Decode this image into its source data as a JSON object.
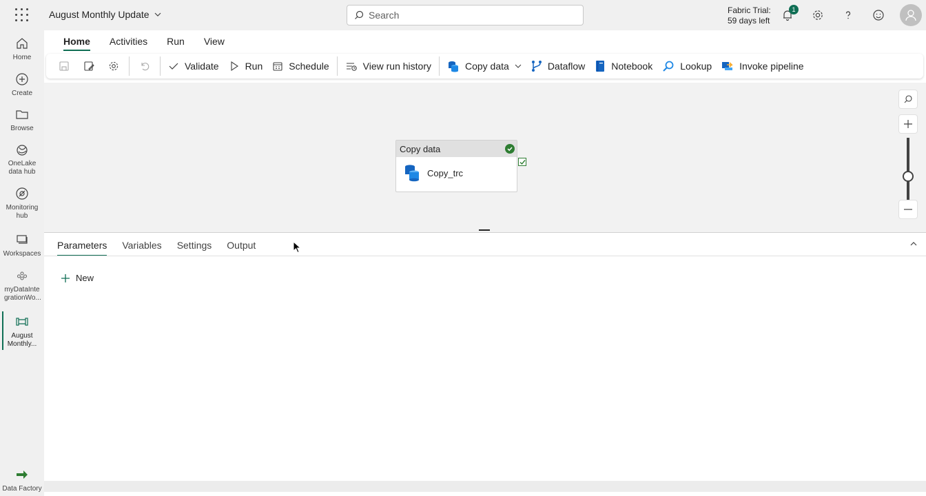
{
  "header": {
    "app_title": "August Monthly Update",
    "search_placeholder": "Search",
    "trial_line1": "Fabric Trial:",
    "trial_line2": "59 days left",
    "notification_count": "1"
  },
  "rail": {
    "items": [
      {
        "label": "Home",
        "icon": "home-icon"
      },
      {
        "label": "Create",
        "icon": "plus-circle-icon"
      },
      {
        "label": "Browse",
        "icon": "folder-icon"
      },
      {
        "label": "OneLake data hub",
        "icon": "onelake-icon"
      },
      {
        "label": "Monitoring hub",
        "icon": "monitoring-icon"
      },
      {
        "label": "Workspaces",
        "icon": "workspaces-icon"
      },
      {
        "label": "myDataInte grationWo...",
        "icon": "workspace-icon"
      },
      {
        "label": "August Monthly...",
        "icon": "pipeline-icon"
      }
    ],
    "footer_label": "Data Factory"
  },
  "ribbon": {
    "tabs": [
      "Home",
      "Activities",
      "Run",
      "View"
    ],
    "active_tab": "Home"
  },
  "toolbar": {
    "validate": "Validate",
    "run": "Run",
    "schedule": "Schedule",
    "view_run_history": "View run history",
    "copy_data": "Copy data",
    "dataflow": "Dataflow",
    "notebook": "Notebook",
    "lookup": "Lookup",
    "invoke_pipeline": "Invoke pipeline"
  },
  "canvas": {
    "activity": {
      "type_label": "Copy data",
      "name": "Copy_trc",
      "status": "succeeded"
    }
  },
  "panel": {
    "tabs": [
      "Parameters",
      "Variables",
      "Settings",
      "Output"
    ],
    "active_tab": "Parameters",
    "new_label": "New"
  },
  "colors": {
    "accent": "#0f6e54",
    "success": "#2e7d32",
    "copy_icon_blue": "#1565c0"
  }
}
